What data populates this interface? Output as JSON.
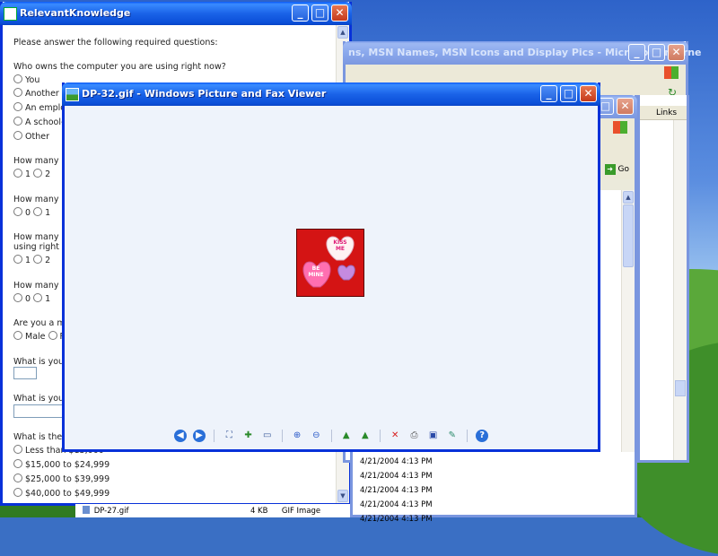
{
  "survey_window": {
    "title": "RelevantKnowledge",
    "intro": "Please answer the following required questions:",
    "q1": "Who owns the computer you are using right now?",
    "q1_options": [
      "You",
      "Another",
      "An emplo",
      "A school-",
      "Other"
    ],
    "q2": "How many p",
    "q2_options": [
      "1",
      "2"
    ],
    "q3": "How many c",
    "q3_options": [
      "0",
      "1"
    ],
    "q4": "How many p",
    "q4_line2": "using right n",
    "q4_options": [
      "1",
      "2"
    ],
    "q5": "How many o",
    "q5_options": [
      "0",
      "1"
    ],
    "q6": "Are you a m",
    "q6_options": [
      "Male",
      "F"
    ],
    "q7": "What is your",
    "q8": "What is your",
    "q9": "What is the t",
    "q9_options": [
      "Less than $15,000",
      "$15,000 to $24,999",
      "$25,000 to $39,999",
      "$40,000 to $49,999"
    ]
  },
  "ie_window": {
    "title": "ns, MSN Names, MSN Icons and Display Pics - Microsoft Interne"
  },
  "explorer_window": {
    "links_label": "Links",
    "go_label": "Go",
    "rows": [
      {
        "name": "",
        "size": "",
        "type": "",
        "date": "4/21/2004 4:13 PM"
      },
      {
        "name": "",
        "size": "",
        "type": "",
        "date": "4/21/2004 4:13 PM"
      },
      {
        "name": "",
        "size": "",
        "type": "",
        "date": "4/21/2004 4:13 PM"
      },
      {
        "name": "",
        "size": "",
        "type": "",
        "date": "4/21/2004 4:13 PM"
      },
      {
        "name": "DP-27.gif",
        "size": "4 KB",
        "type": "GIF Image",
        "date": "4/21/2004 4:13 PM"
      }
    ]
  },
  "viewer_window": {
    "title": "DP-32.gif - Windows Picture and Fax Viewer",
    "image_text_top": "KISS ME",
    "image_text_bottom": "BE MINE"
  }
}
